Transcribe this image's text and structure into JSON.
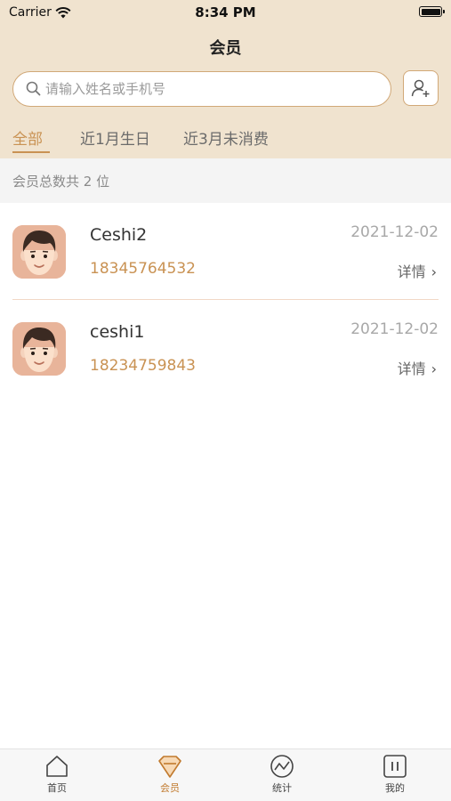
{
  "status_bar": {
    "carrier": "Carrier",
    "time": "8:34 PM"
  },
  "nav": {
    "title": "会员"
  },
  "search": {
    "placeholder": "请输入姓名或手机号"
  },
  "tabs": [
    {
      "label": "全部",
      "active": true
    },
    {
      "label": "近1月生日",
      "active": false
    },
    {
      "label": "近3月未消费",
      "active": false
    }
  ],
  "summary": {
    "text": "会员总数共 2 位"
  },
  "members": [
    {
      "name": "Ceshi2",
      "phone": "18345764532",
      "date": "2021-12-02",
      "detail_label": "详情"
    },
    {
      "name": "ceshi1",
      "phone": "18234759843",
      "date": "2021-12-02",
      "detail_label": "详情"
    }
  ],
  "tabbar": [
    {
      "label": "首页",
      "icon": "home-icon",
      "active": false
    },
    {
      "label": "会员",
      "icon": "diamond-icon",
      "active": true
    },
    {
      "label": "统计",
      "icon": "stats-icon",
      "active": false
    },
    {
      "label": "我的",
      "icon": "profile-icon",
      "active": false
    }
  ],
  "colors": {
    "accent": "#c99253",
    "header_bg": "#f0e3cf",
    "tabbar_active": "#c17a2e"
  }
}
